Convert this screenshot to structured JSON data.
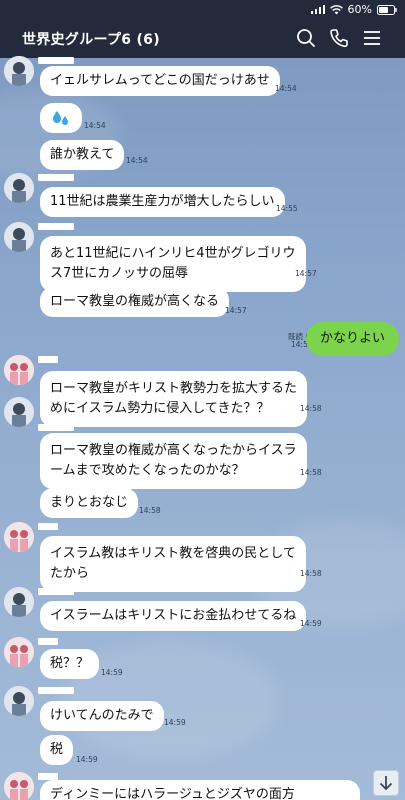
{
  "status": {
    "battery": "60%"
  },
  "header": {
    "title": "世界史グループ6 (6)"
  },
  "messages": [
    {
      "text": "イェルサレムってどこの国だっけあせ",
      "time": "14:54"
    },
    {
      "sticker": "sweat-drops",
      "time": "14:54"
    },
    {
      "text": "誰か教えて",
      "time": "14:54"
    },
    {
      "text": "11世紀は農業生産力が増大したらしい",
      "time": "14:55"
    },
    {
      "text1": "あと11世紀にハインリヒ4世がグレゴリウ",
      "text2": "ス7世にカノッサの屈辱",
      "time": "14:57"
    },
    {
      "text": "ローマ教皇の権威が高くなる",
      "time": "14:57"
    },
    {
      "text": "ローマ教皇がキリスト教勢力を拡大するた",
      "text2": "めにイスラム勢力に侵入してきた？？",
      "time": "14:58"
    },
    {
      "text": "ローマ教皇の権威が高くなったからイスラ",
      "text2": "ームまで攻めたくなったのかな？",
      "time": "14:58"
    },
    {
      "text": "まりとおなじ",
      "time": "14:58"
    },
    {
      "text": "イスラム教はキリスト教を啓典の民として",
      "text2": "たから",
      "time": "14:58"
    },
    {
      "text": "イスラームはキリストにお金払わせてるね",
      "time": "14:59"
    },
    {
      "text": "税？？",
      "time": "14:59"
    },
    {
      "text": "けいてんのたみで",
      "time": "14:59"
    },
    {
      "text": "税",
      "time": "14:59"
    },
    {
      "text": "ディンミーにはハラージュとジズヤの面方"
    }
  ],
  "mine": {
    "read": "既読 6",
    "time": "14:57",
    "text": "かなりよい"
  }
}
